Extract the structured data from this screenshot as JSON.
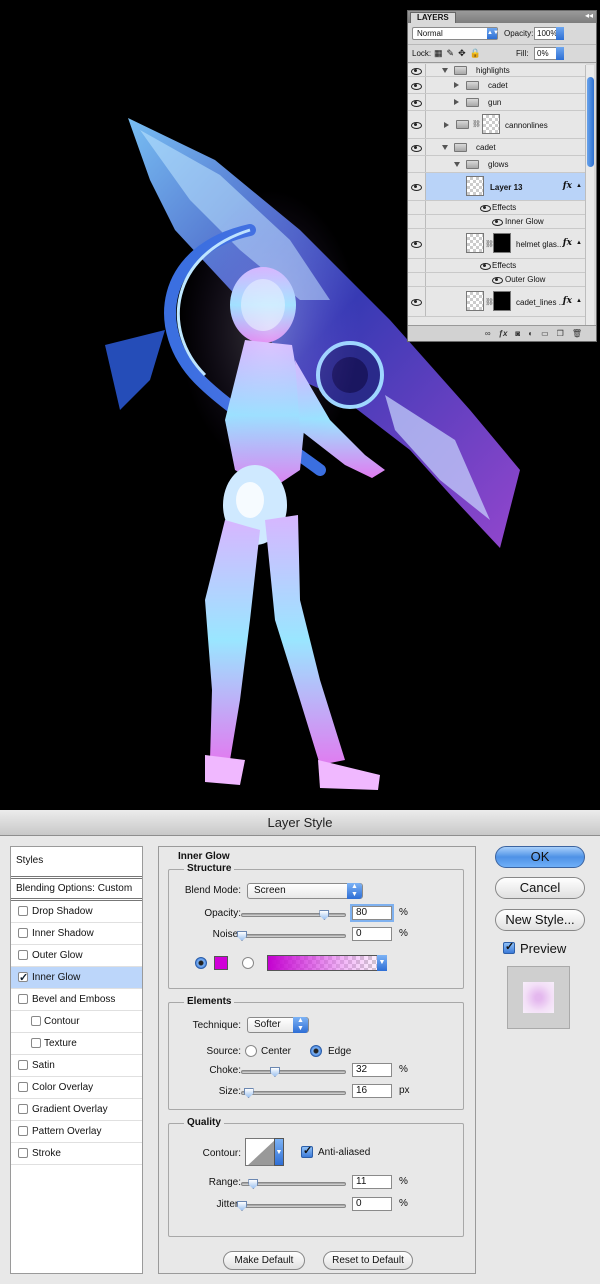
{
  "layers_panel": {
    "tab": "LAYERS",
    "collapse": "◂◂",
    "blend_mode": "Normal",
    "opacity_label": "Opacity:",
    "opacity_value": "100%",
    "lock_label": "Lock:",
    "fill_label": "Fill:",
    "fill_value": "0%",
    "layers": [
      {
        "name": "highlights"
      },
      {
        "name": "cadet"
      },
      {
        "name": "gun"
      },
      {
        "name": "cannonlines"
      },
      {
        "name": "cadet"
      },
      {
        "name": "glows"
      },
      {
        "name": "Layer 13"
      },
      {
        "name": "Effects"
      },
      {
        "name": "Inner Glow"
      },
      {
        "name": "helmet glas..."
      },
      {
        "name": "Effects"
      },
      {
        "name": "Outer Glow"
      },
      {
        "name": "cadet_lines ..."
      }
    ],
    "fx": "fx"
  },
  "dialog": {
    "title": "Layer Style",
    "styles_header": "Styles",
    "blending_options": "Blending Options: Custom",
    "style_items": [
      {
        "label": "Drop Shadow",
        "checked": false
      },
      {
        "label": "Inner Shadow",
        "checked": false
      },
      {
        "label": "Outer Glow",
        "checked": false
      },
      {
        "label": "Inner Glow",
        "checked": true
      },
      {
        "label": "Bevel and Emboss",
        "checked": false
      },
      {
        "label": "Contour",
        "checked": false
      },
      {
        "label": "Texture",
        "checked": false
      },
      {
        "label": "Satin",
        "checked": false
      },
      {
        "label": "Color Overlay",
        "checked": false
      },
      {
        "label": "Gradient Overlay",
        "checked": false
      },
      {
        "label": "Pattern Overlay",
        "checked": false
      },
      {
        "label": "Stroke",
        "checked": false
      }
    ],
    "panel_title": "Inner Glow",
    "structure": {
      "title": "Structure",
      "blend_mode_label": "Blend Mode:",
      "blend_mode": "Screen",
      "opacity_label": "Opacity:",
      "opacity": "80",
      "noise_label": "Noise:",
      "noise": "0",
      "percent": "%",
      "glow_color": "#d000d8"
    },
    "elements": {
      "title": "Elements",
      "technique_label": "Technique:",
      "technique": "Softer",
      "source_label": "Source:",
      "source_center": "Center",
      "source_edge": "Edge",
      "choke_label": "Choke:",
      "choke": "32",
      "size_label": "Size:",
      "size": "16",
      "px": "px"
    },
    "quality": {
      "title": "Quality",
      "contour_label": "Contour:",
      "anti_aliased": "Anti-aliased",
      "range_label": "Range:",
      "range": "11",
      "jitter_label": "Jitter:",
      "jitter": "0"
    },
    "make_default": "Make Default",
    "reset_default": "Reset to Default",
    "ok": "OK",
    "cancel": "Cancel",
    "new_style": "New Style...",
    "preview": "Preview"
  }
}
